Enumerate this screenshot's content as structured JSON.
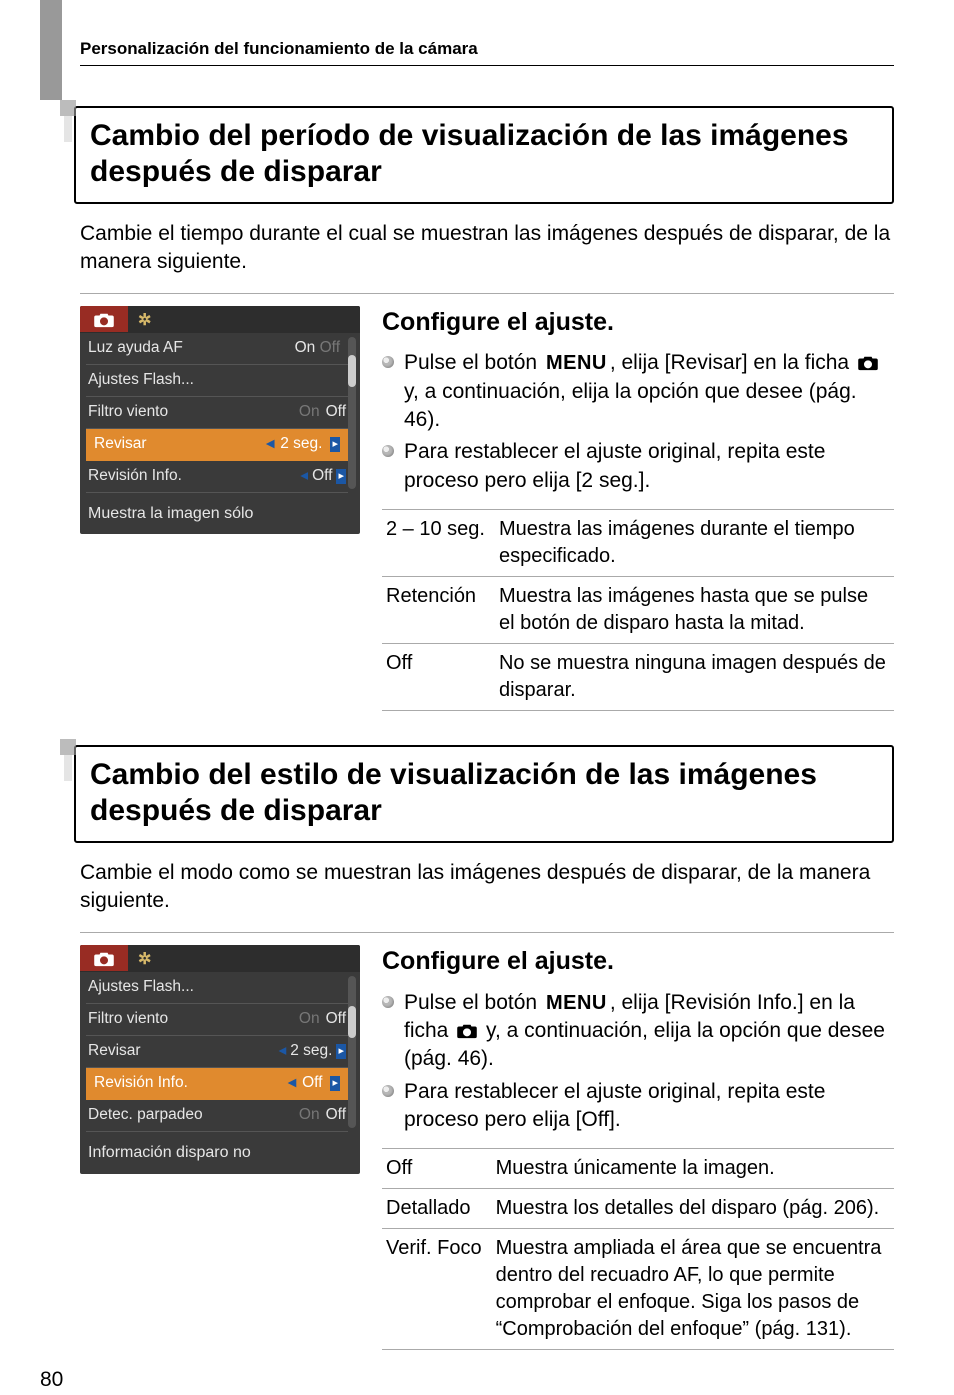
{
  "breadcrumb": "Personalización del funcionamiento de la cámara",
  "section1": {
    "title": "Cambio del período de visualización de las imágenes después de disparar",
    "lead": "Cambie el tiempo durante el cual se muestran las imágenes después de disparar, de la manera siguiente.",
    "ui": {
      "rows": [
        {
          "k": "Luz ayuda AF",
          "dim": null,
          "v": "On",
          "trail_dim": "Off"
        },
        {
          "k": "Ajustes Flash...",
          "dim": null,
          "v": ""
        },
        {
          "k": "Filtro viento",
          "dim": "On",
          "v": "Off"
        },
        {
          "k": "Revisar",
          "sel": true,
          "v": "2 seg."
        },
        {
          "k": "Revisión Info.",
          "v": "Off",
          "sub": true
        }
      ],
      "caption": "Muestra la imagen sólo"
    },
    "right_heading": "Configure el ajuste.",
    "bullets": [
      "Pulse el botón {MENU}, elija [Revisar] en la ficha {CAM} y, a continuación, elija la opción que desee (pág. 46).",
      "Para restablecer el ajuste original, repita este proceso pero elija [2 seg.]."
    ],
    "options": [
      {
        "k": "2 – 10 seg.",
        "v": "Muestra las imágenes durante el tiempo especificado."
      },
      {
        "k": "Retención",
        "v": "Muestra las imágenes hasta que se pulse el botón de disparo hasta la mitad."
      },
      {
        "k": "Off",
        "v": "No se muestra ninguna imagen después de disparar."
      }
    ]
  },
  "section2": {
    "title": "Cambio del estilo de visualización de las imágenes después de disparar",
    "lead": "Cambie el modo como se muestran las imágenes después de disparar, de la manera siguiente.",
    "ui": {
      "rows": [
        {
          "k": "Ajustes Flash...",
          "v": ""
        },
        {
          "k": "Filtro viento",
          "dim": "On",
          "v": "Off"
        },
        {
          "k": "Revisar",
          "v": "2 seg.",
          "sub": true
        },
        {
          "k": "Revisión Info.",
          "sel": true,
          "v": "Off"
        },
        {
          "k": "Detec. parpadeo",
          "dim": "On",
          "v": "Off"
        }
      ],
      "caption": "Información disparo no"
    },
    "right_heading": "Configure el ajuste.",
    "bullets": [
      "Pulse el botón {MENU}, elija [Revisión Info.] en la ficha {CAM} y, a continuación, elija la opción que desee (pág. 46).",
      "Para restablecer el ajuste original, repita este proceso pero elija [Off]."
    ],
    "options": [
      {
        "k": "Off",
        "v": "Muestra únicamente la imagen."
      },
      {
        "k": "Detallado",
        "v": "Muestra los detalles del disparo (pág. 206)."
      },
      {
        "k": "Verif. Foco",
        "v": "Muestra ampliada el área que se encuentra dentro del recuadro AF, lo que permite comprobar el enfoque. Siga los pasos de “Comprobación del enfoque” (pág. 131)."
      }
    ]
  },
  "page_number": "80",
  "glyphs": {
    "menu": "MENU"
  }
}
